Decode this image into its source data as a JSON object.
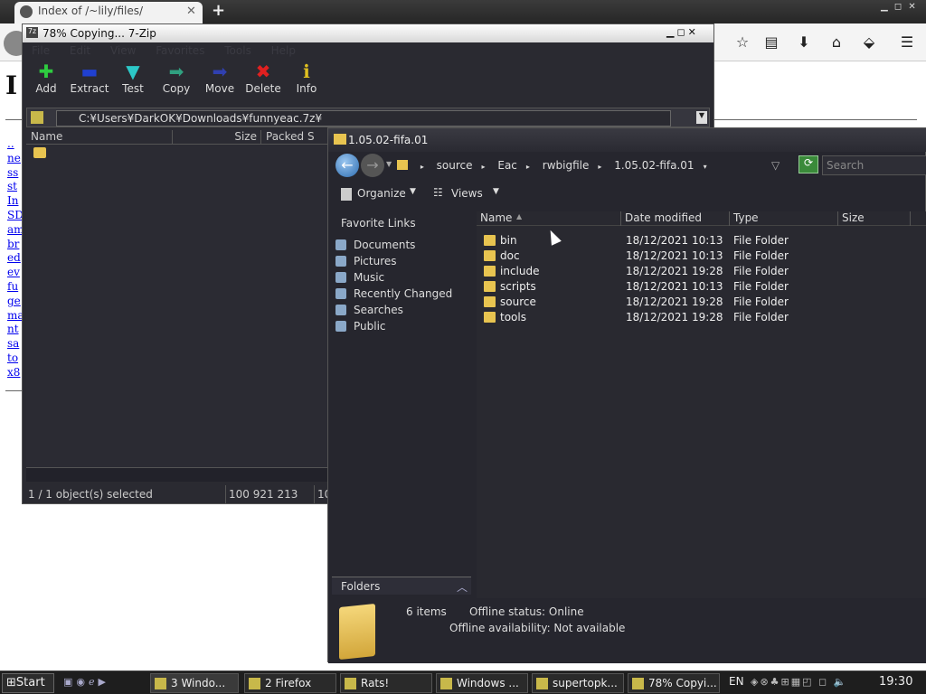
{
  "firefox": {
    "tab_title": "Index of /~lily/files/",
    "page_heading": "I",
    "links": [
      "..",
      "ne",
      "ss",
      "st",
      "In",
      "SD",
      "am",
      "br",
      "ed",
      "ev",
      "fu",
      "ge",
      "ma",
      "nt",
      "sa",
      "to",
      "x8"
    ]
  },
  "zip": {
    "title": "78% Copying... 7-Zip",
    "menu": "File Edit View Favorites Tools Help",
    "tools": [
      {
        "label": "Add",
        "glyph": "✚",
        "color": "#2ecc40"
      },
      {
        "label": "Extract",
        "glyph": "▬",
        "color": "#2040d0"
      },
      {
        "label": "Test",
        "glyph": "▼",
        "color": "#2cc8c8"
      },
      {
        "label": "Copy",
        "glyph": "➡",
        "color": "#30a080"
      },
      {
        "label": "Move",
        "glyph": "➡",
        "color": "#3040b0"
      },
      {
        "label": "Delete",
        "glyph": "✖",
        "color": "#e02020"
      },
      {
        "label": "Info",
        "glyph": "ℹ",
        "color": "#e0c020"
      }
    ],
    "path": "C:¥Users¥DarkOK¥Downloads¥funnyeac.7z¥",
    "col_name": "Name",
    "col_size": "Size",
    "col_packed": "Packed S",
    "status_selected": "1 / 1 object(s) selected",
    "status_size": "100 921 213",
    "status_size2": "10"
  },
  "explorer": {
    "title": "1.05.02-fifa.01",
    "crumbs": [
      "source",
      "Eac",
      "rwbigfile",
      "1.05.02-fifa.01"
    ],
    "search_placeholder": "Search",
    "organize": "Organize",
    "views": "Views",
    "favorites_title": "Favorite Links",
    "favorites": [
      "Documents",
      "Pictures",
      "Music",
      "Recently Changed",
      "Searches",
      "Public"
    ],
    "headers": {
      "name": "Name",
      "date": "Date modified",
      "type": "Type",
      "size": "Size"
    },
    "rows": [
      {
        "name": "bin",
        "date": "18/12/2021 10:13",
        "type": "File Folder"
      },
      {
        "name": "doc",
        "date": "18/12/2021 10:13",
        "type": "File Folder"
      },
      {
        "name": "include",
        "date": "18/12/2021 19:28",
        "type": "File Folder"
      },
      {
        "name": "scripts",
        "date": "18/12/2021 10:13",
        "type": "File Folder"
      },
      {
        "name": "source",
        "date": "18/12/2021 19:28",
        "type": "File Folder"
      },
      {
        "name": "tools",
        "date": "18/12/2021 19:28",
        "type": "File Folder"
      }
    ],
    "folders_label": "Folders",
    "item_count": "6 items",
    "offline_status": "Offline status: Online",
    "offline_availability": "Offline availability: Not available"
  },
  "taskbar": {
    "start": "Start",
    "buttons": [
      "3 Windo...",
      "2 Firefox",
      "Rats!",
      "Windows ...",
      "supertopk...",
      "78% Copyi..."
    ],
    "lang": "EN",
    "clock": "19:30"
  }
}
